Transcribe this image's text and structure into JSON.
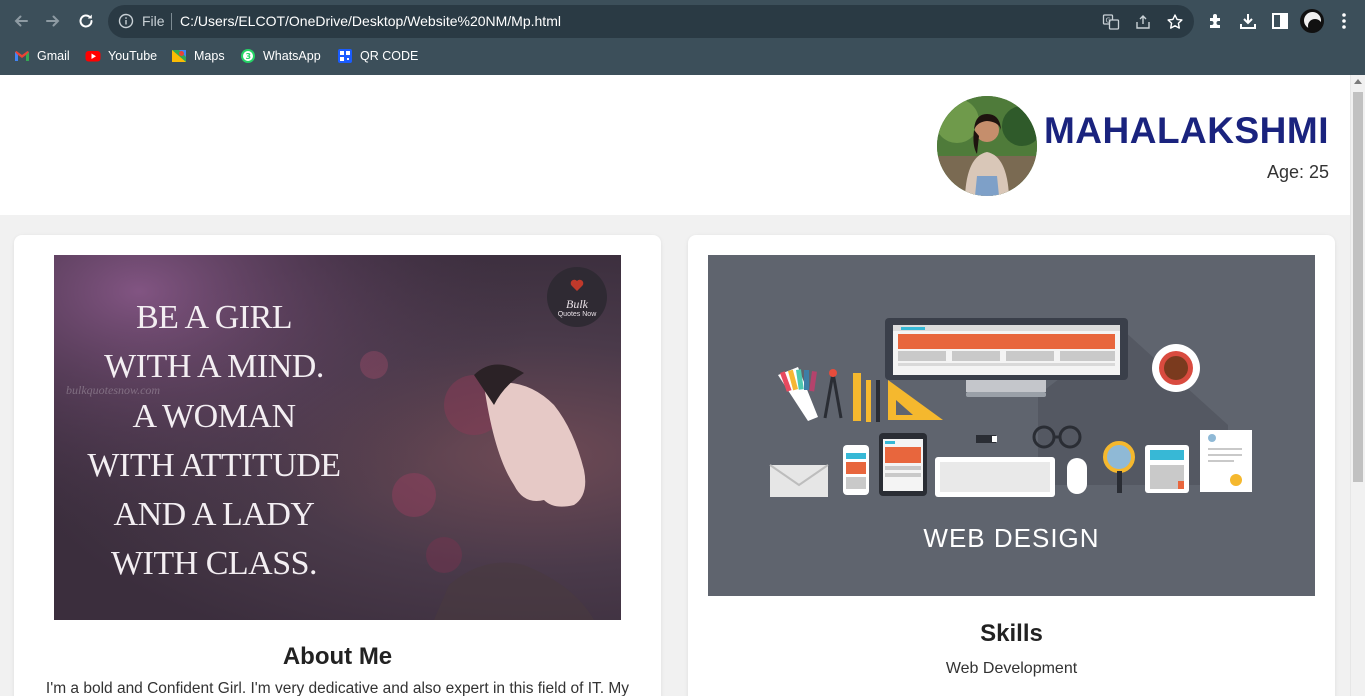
{
  "browser": {
    "omnibox": {
      "scheme_label": "File",
      "url": "C:/Users/ELCOT/OneDrive/Desktop/Website%20NM/Mp.html"
    },
    "bookmarks": [
      {
        "label": "Gmail",
        "icon": "gmail-icon"
      },
      {
        "label": "YouTube",
        "icon": "youtube-icon"
      },
      {
        "label": "Maps",
        "icon": "maps-icon"
      },
      {
        "label": "WhatsApp",
        "icon": "whatsapp-icon"
      },
      {
        "label": "QR CODE",
        "icon": "qr-code-icon"
      }
    ]
  },
  "header": {
    "name": "MAHALAKSHMI",
    "age": "Age: 25"
  },
  "about": {
    "quote_lines": [
      "BE A GIRL",
      "WITH A MIND.",
      "A WOMAN",
      "WITH ATTITUDE",
      "AND A LADY",
      "WITH CLASS."
    ],
    "quote_brand_top": "Bulk",
    "quote_brand_bottom": "Quotes Now",
    "quote_watermark": "bulkquotesnow.com",
    "title": "About Me",
    "text": "I'm a bold and Confident Girl. I'm very dedicative and also expert in this field of IT. My"
  },
  "skills": {
    "image_caption": "WEB DESIGN",
    "title": "Skills",
    "text": "Web Development"
  },
  "colors": {
    "chrome_bg": "#3c4f5a",
    "name_color": "#1a237e",
    "page_bg": "#f1f1f1"
  }
}
